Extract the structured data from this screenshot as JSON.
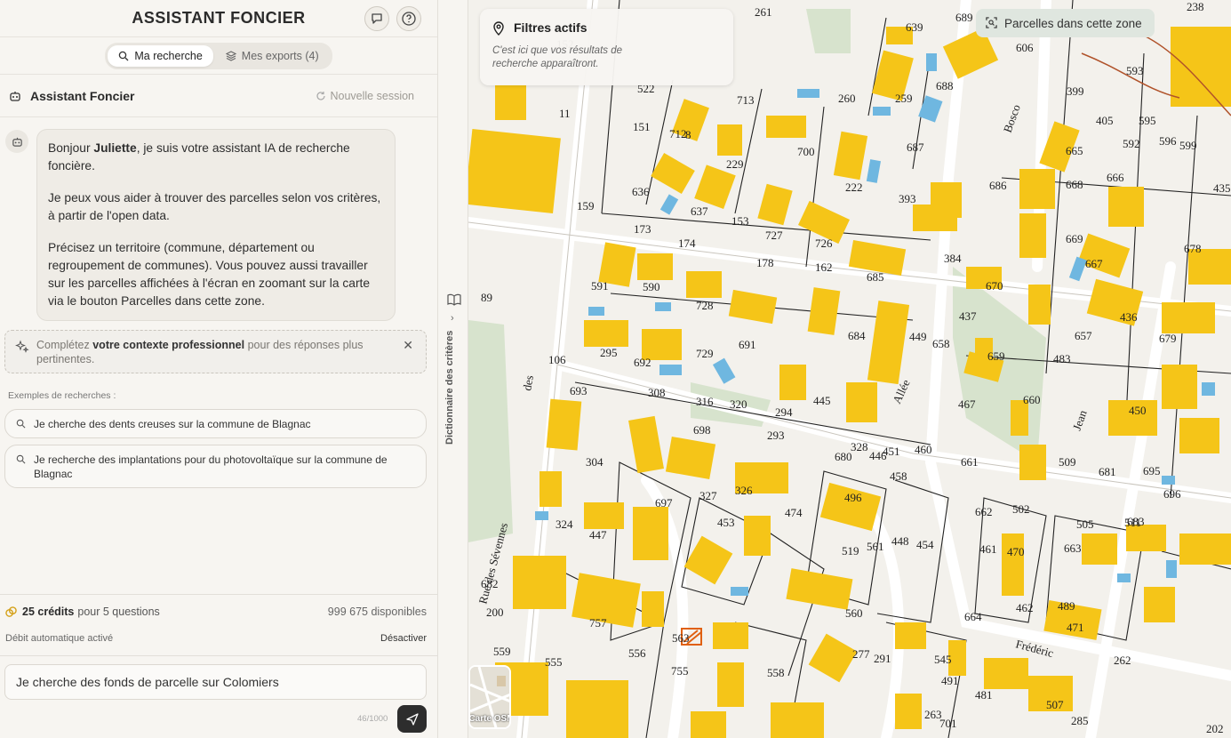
{
  "header": {
    "title": "ASSISTANT FONCIER",
    "icons": [
      "chat-icon",
      "help-icon"
    ]
  },
  "tabs": [
    {
      "label": "Ma recherche",
      "active": true
    },
    {
      "label": "Mes exports (4)",
      "active": false
    }
  ],
  "session": {
    "title": "Assistant Foncier",
    "new_session": "Nouvelle session"
  },
  "chat": {
    "greeting_pre": "Bonjour ",
    "user_name": "Juliette",
    "greeting_post": ", je suis votre assistant IA de recherche foncière.",
    "para2": "Je peux vous aider à trouver des parcelles selon vos critères, à partir de l'open data.",
    "para3": "Précisez un territoire (commune, département ou regroupement de communes). Vous pouvez aussi travailler sur les parcelles affichées à l'écran en zoomant sur la carte via le bouton Parcelles dans cette zone."
  },
  "context_tip": {
    "pre": "Complétez ",
    "bold": "votre contexte professionnel",
    "post": " pour des réponses plus pertinentes."
  },
  "examples": {
    "label": "Exemples de recherches :",
    "items": [
      "Je cherche des dents creuses sur la commune de Blagnac",
      "Je recherche des implantations pour du photovoltaïque sur la commune de Blagnac"
    ]
  },
  "credits": {
    "amount": "25 crédits",
    "questions": "pour 5 questions",
    "available": "999 675 disponibles",
    "debit": "Débit automatique activé",
    "disable": "Désactiver"
  },
  "input": {
    "value": "Je cherche des fonds de parcelle sur Colomiers",
    "counter": "46/1000"
  },
  "strip": {
    "label": "Dictionnaire des critères"
  },
  "map": {
    "filters_title": "Filtres actifs",
    "filters_desc": "C'est ici que vos résultats de recherche apparaîtront.",
    "zone_button": "Parcelles dans cette zone",
    "osm_label": "Carte OSM",
    "street_labels": [
      "Rue des Sévennes",
      "Bosco",
      "Allée",
      "Jean",
      "Frédéric",
      "des"
    ],
    "parcel_numbers": [
      "261",
      "639",
      "689",
      "238",
      "606",
      "593",
      "399",
      "405",
      "595",
      "599",
      "592",
      "596",
      "435",
      "11",
      "713",
      "260",
      "259",
      "688",
      "151",
      "712",
      "700",
      "687",
      "665",
      "668",
      "666",
      "229",
      "222",
      "636",
      "637",
      "393",
      "686",
      "159",
      "173",
      "174",
      "153",
      "727",
      "726",
      "669",
      "667",
      "162",
      "178",
      "685",
      "384",
      "678",
      "591",
      "590",
      "728",
      "691",
      "684",
      "670",
      "436",
      "89",
      "295",
      "692",
      "729",
      "449",
      "437",
      "658",
      "659",
      "657",
      "679",
      "483",
      "106",
      "693",
      "308",
      "316",
      "320",
      "294",
      "445",
      "467",
      "660",
      "698",
      "293",
      "450",
      "680",
      "328",
      "446",
      "451",
      "460",
      "661",
      "304",
      "697",
      "327",
      "326",
      "458",
      "662",
      "502",
      "509",
      "681",
      "695",
      "696",
      "324",
      "447",
      "453",
      "474",
      "496",
      "519",
      "561",
      "448",
      "454",
      "461",
      "470",
      "663",
      "505",
      "511",
      "683",
      "682",
      "757",
      "560",
      "462",
      "664",
      "489",
      "200",
      "563",
      "559",
      "555",
      "556",
      "755",
      "558",
      "277",
      "291",
      "471",
      "262",
      "545",
      "491",
      "481",
      "507",
      "263",
      "701",
      "285",
      "202",
      "522",
      "152",
      "8",
      "712"
    ]
  }
}
